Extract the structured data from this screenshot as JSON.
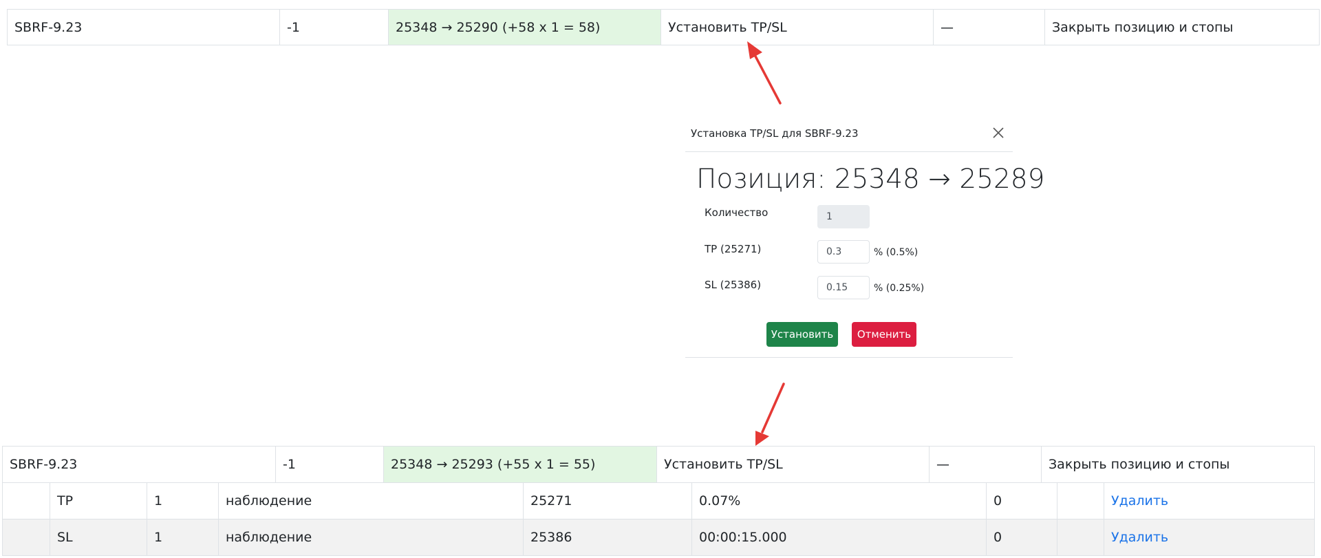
{
  "top_row": {
    "symbol": "SBRF-9.23",
    "qty": "-1",
    "pnl": "25348 → 25290 (+58 x 1 = 58)",
    "set_tpsl": "Установить TP/SL",
    "dash": "—",
    "close": "Закрыть позицию и стопы"
  },
  "modal": {
    "title": "Установка TP/SL для SBRF-9.23",
    "heading": "Позиция: 25348 → 25289",
    "fields": [
      {
        "label": "Количество",
        "value": "1",
        "suffix": ""
      },
      {
        "label": "TP (25271)",
        "value": "0.3",
        "suffix": "% (0.5%)"
      },
      {
        "label": "SL (25386)",
        "value": "0.15",
        "suffix": "% (0.25%)"
      }
    ],
    "confirm_label": "Установить",
    "cancel_label": "Отменить"
  },
  "bottom_row": {
    "symbol": "SBRF-9.23",
    "qty": "-1",
    "pnl": "25348 → 25293 (+55 x 1 = 55)",
    "set_tpsl": "Установить TP/SL",
    "dash": "—",
    "close": "Закрыть позицию и стопы"
  },
  "orders": [
    {
      "type": "TP",
      "qty": "1",
      "status": "наблюдение",
      "price": "25271",
      "param": "0.07%",
      "filled": "0",
      "action": "Удалить"
    },
    {
      "type": "SL",
      "qty": "1",
      "status": "наблюдение",
      "price": "25386",
      "param": "00:00:15.000",
      "filled": "0",
      "action": "Удалить"
    }
  ],
  "colors": {
    "accent_green": "#1e8449",
    "accent_red": "#dc1e40",
    "pnl_bg": "#e2f6e2",
    "link": "#1a73e8",
    "arrow": "#e53935"
  }
}
